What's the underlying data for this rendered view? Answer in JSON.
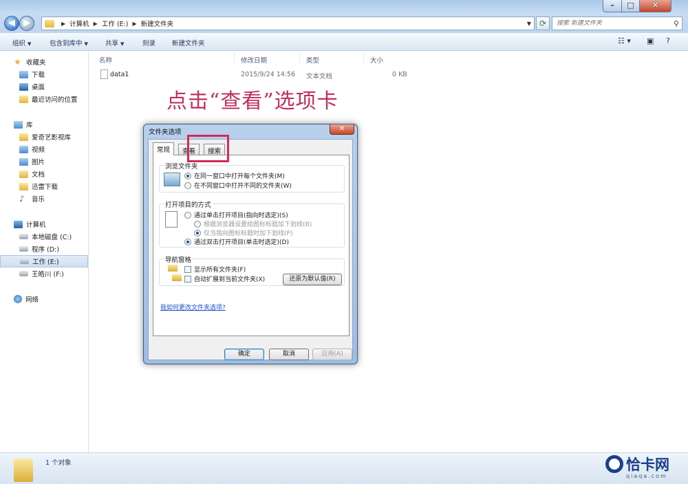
{
  "window": {
    "min_glyph": "–",
    "max_glyph": "□",
    "close_glyph": "✕"
  },
  "address": {
    "crumbs": [
      "计算机",
      "工作 (E:)",
      "新建文件夹"
    ]
  },
  "search": {
    "placeholder": "搜索 新建文件夹"
  },
  "toolbar": {
    "organize": "组织",
    "include_in_library": "包含到库中",
    "share": "共享",
    "burn": "刻录",
    "new_folder": "新建文件夹"
  },
  "sidebar": {
    "favorites": "收藏夹",
    "favorites_items": [
      "下载",
      "桌面",
      "最近访问的位置"
    ],
    "libraries": "库",
    "library_items": [
      "爱奇艺影视库",
      "视频",
      "图片",
      "文档",
      "迅雷下载",
      "音乐"
    ],
    "computer": "计算机",
    "computer_items": [
      "本地磁盘 (C:)",
      "程序 (D:)",
      "工作 (E:)",
      "王皓川 (F:)"
    ],
    "network": "网络"
  },
  "columns": {
    "name": "名称",
    "modified": "修改日期",
    "type": "类型",
    "size": "大小"
  },
  "files": [
    {
      "name": "data1",
      "modified": "2015/9/24 14:56",
      "type": "文本文档",
      "size": "0 KB"
    }
  ],
  "annotation": "点击“查看”选项卡",
  "status": {
    "count": "1 个对象"
  },
  "watermark": {
    "brand": "恰卡网",
    "sub": "qiaqa.com"
  },
  "dialog": {
    "title": "文件夹选项",
    "close_glyph": "✕",
    "tabs": [
      "常规",
      "查看",
      "搜索"
    ],
    "browse_group": {
      "title": "浏览文件夹",
      "options": [
        "在同一窗口中打开每个文件夹(M)",
        "在不同窗口中打开不同的文件夹(W)"
      ]
    },
    "open_group": {
      "title": "打开项目的方式",
      "options": [
        "通过单击打开项目(指向时选定)(S)",
        "根据浏览器设置给图标标题加下划线(B)",
        "仅当指向图标标题时加下划线(P)",
        "通过双击打开项目(单击时选定)(D)"
      ]
    },
    "nav_group": {
      "title": "导航窗格",
      "options": [
        "显示所有文件夹(F)",
        "自动扩展到当前文件夹(X)"
      ]
    },
    "restore_defaults": "还原为默认值(R)",
    "help_link": "我如何更改文件夹选项?",
    "ok": "确定",
    "cancel": "取消",
    "apply": "应用(A)"
  }
}
